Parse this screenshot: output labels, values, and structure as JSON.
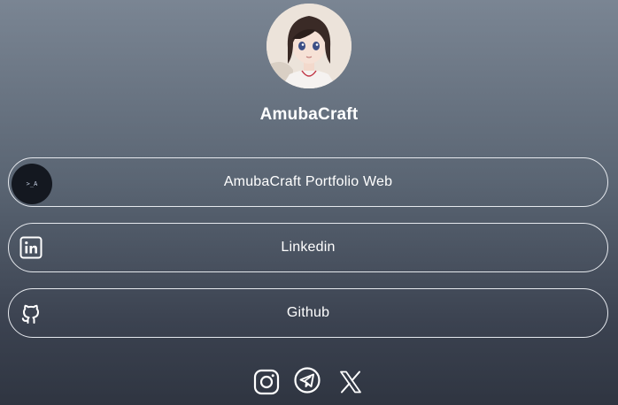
{
  "profile": {
    "name": "AmubaCraft",
    "avatar_icon": "anime-girl-avatar"
  },
  "links": [
    {
      "label": "AmubaCraft Portfolio Web",
      "icon": "portfolio-logo-icon",
      "logo_text": ">_A"
    },
    {
      "label": "Linkedin",
      "icon": "linkedin-icon"
    },
    {
      "label": "Github",
      "icon": "github-icon"
    }
  ],
  "social": [
    {
      "icon": "instagram-icon"
    },
    {
      "icon": "telegram-icon"
    },
    {
      "icon": "x-icon"
    }
  ],
  "colors": {
    "background_top": "#7a8593",
    "background_bottom": "#2f3541",
    "text": "#ffffff",
    "button_border": "#e6e9ee"
  }
}
